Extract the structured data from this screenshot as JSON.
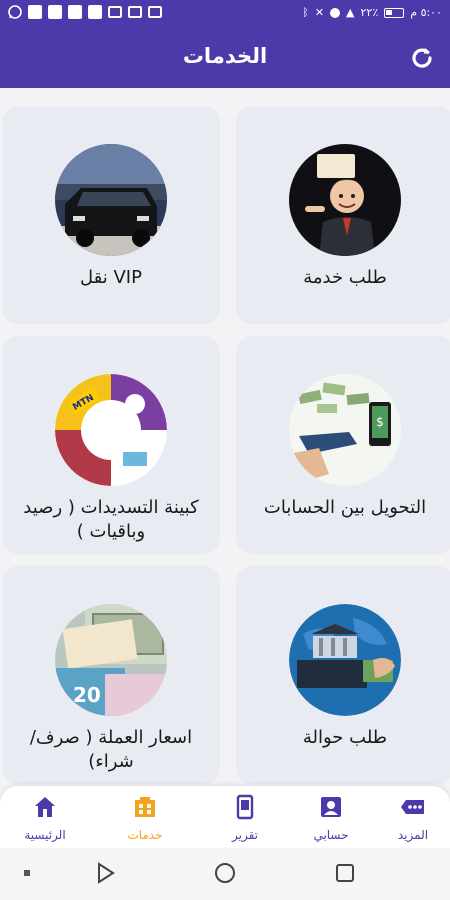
{
  "status_bar": {
    "time": "٥:٠٠ م",
    "battery": "٢٢٪"
  },
  "app_bar": {
    "title": "الخدمات",
    "refresh_icon": "refresh-icon"
  },
  "services": [
    {
      "label": "طلب خدمة",
      "icon": "service-request-avatar"
    },
    {
      "label": "VIP نقل",
      "icon": "vip-car-image"
    },
    {
      "label": "التحويل بين الحسابات",
      "icon": "money-transfer-image"
    },
    {
      "label": "كبينة التسديدات ( رصيد وباقيات )",
      "icon": "payments-cabin-image"
    },
    {
      "label": "طلب حوالة",
      "icon": "remittance-globe-image"
    },
    {
      "label": "اسعار العملة ( صرف/ شراء)",
      "icon": "currency-notes-image"
    }
  ],
  "bottom_nav": {
    "items": [
      {
        "label": "الرئيسية",
        "icon": "home-icon"
      },
      {
        "label": "خدمات",
        "icon": "services-icon"
      },
      {
        "label": "تقرير",
        "icon": "report-icon"
      },
      {
        "label": "حسابي",
        "icon": "account-icon"
      },
      {
        "label": "المزيد",
        "icon": "more-icon"
      }
    ],
    "active_index": 1
  },
  "colors": {
    "primary": "#4b3aa9",
    "active": "#f2a21b",
    "card": "#e9ebf3"
  }
}
